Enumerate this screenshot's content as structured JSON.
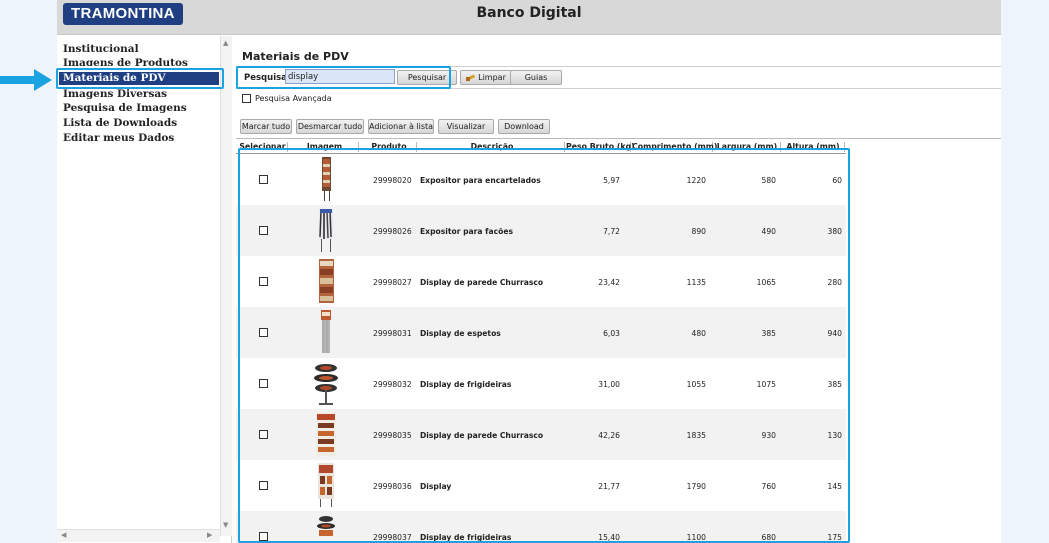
{
  "header": {
    "logo": "TRAMONTINA",
    "title": "Banco Digital"
  },
  "sidebar": {
    "items": [
      {
        "label": "Institucional"
      },
      {
        "label": "Imagens de Produtos"
      },
      {
        "label": "Materiais de PDV",
        "active": true
      },
      {
        "label": "Imagens Diversas"
      },
      {
        "label": "Pesquisa de Imagens"
      },
      {
        "label": "Lista de Downloads"
      },
      {
        "label": "Editar meus Dados"
      }
    ]
  },
  "main": {
    "title": "Materiais de PDV",
    "search": {
      "label": "Pesquisa:",
      "value": "display"
    },
    "buttons": {
      "search": "Pesquisar",
      "clear": "Limpar",
      "guides": "Guias"
    },
    "advanced_search": "Pesquisa Avançada",
    "actions": [
      "Marcar tudo",
      "Desmarcar tudo",
      "Adicionar à lista",
      "Visualizar",
      "Download"
    ],
    "columns": [
      "Selecionar",
      "Imagem",
      "Produto",
      "Descrição",
      "Peso Bruto (kg)",
      "Comprimento (mm)",
      "Largura (mm)",
      "Altura (mm)"
    ],
    "rows": [
      {
        "produto": "29998020",
        "descricao": "Expositor para encartelados",
        "peso": "5,97",
        "comprimento": "1220",
        "largura": "580",
        "altura": "60"
      },
      {
        "produto": "29998026",
        "descricao": "Expositor para facões",
        "peso": "7,72",
        "comprimento": "890",
        "largura": "490",
        "altura": "380"
      },
      {
        "produto": "29998027",
        "descricao": "Display de parede Churrasco",
        "peso": "23,42",
        "comprimento": "1135",
        "largura": "1065",
        "altura": "280"
      },
      {
        "produto": "29998031",
        "descricao": "Display de espetos",
        "peso": "6,03",
        "comprimento": "480",
        "largura": "385",
        "altura": "940"
      },
      {
        "produto": "29998032",
        "descricao": "Display de frigideiras",
        "peso": "31,00",
        "comprimento": "1055",
        "largura": "1075",
        "altura": "385"
      },
      {
        "produto": "29998035",
        "descricao": "Display de parede Churrasco",
        "peso": "42,26",
        "comprimento": "1835",
        "largura": "930",
        "altura": "130"
      },
      {
        "produto": "29998036",
        "descricao": "Display",
        "peso": "21,77",
        "comprimento": "1790",
        "largura": "760",
        "altura": "145"
      },
      {
        "produto": "29998037",
        "descricao": "Display de frigideiras",
        "peso": "15,40",
        "comprimento": "1100",
        "largura": "680",
        "altura": "175"
      }
    ]
  },
  "colors": {
    "brand": "#1f3f82",
    "highlight": "#1aa3e0"
  }
}
